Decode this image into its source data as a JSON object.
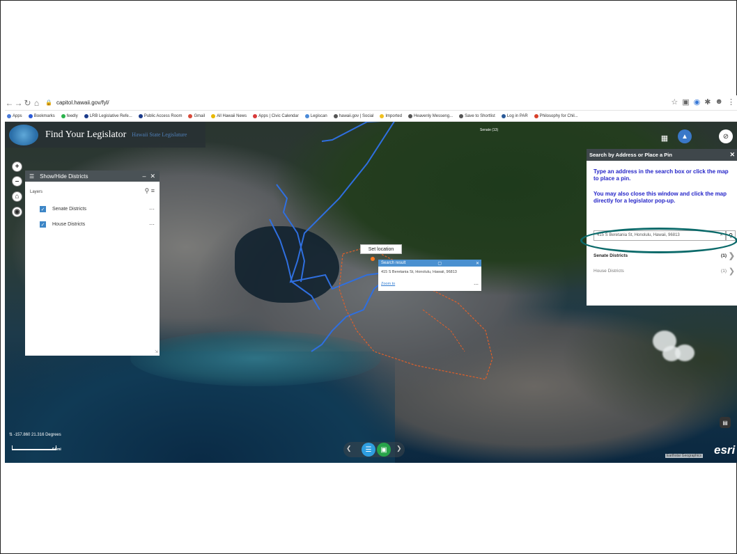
{
  "browser": {
    "url": "capitol.hawaii.gov/fyl/",
    "bookmarks": [
      "Apps",
      "Bookmarks",
      "feedly",
      "LRB Legislative Refe...",
      "Public Access Room",
      "Gmail",
      "All Hawaii News",
      "Apps | Civic Calendar",
      "Legiscan",
      "hawaii.gov | Social",
      "Imported",
      "Heavenly Messeng...",
      "Save to Shortlist",
      "Log in PAR",
      "Philosophy for Chil..."
    ]
  },
  "app": {
    "title": "Find Your Legislator",
    "subtitle": "Hawaii State Legislature"
  },
  "layers_panel": {
    "title": "Show/Hide Districts",
    "minimize": "–",
    "close": "✕",
    "label": "Layers",
    "layers": [
      "Senate Districts",
      "House Districts"
    ]
  },
  "search_panel": {
    "title": "Search by Address or Place a Pin",
    "close": "✕",
    "instructions1": "Type an address in the search box or click the map to place a pin.",
    "instructions2": "You may also close this window and click the map directly for a legislator pop-up.",
    "search_value": "415 S Beretania St, Honolulu, Hawaii, 96813",
    "clear": "✕",
    "results": [
      {
        "label": "Senate Districts",
        "count": "(1)"
      },
      {
        "label": "House Districts",
        "count": "(1)"
      }
    ]
  },
  "map": {
    "set_location": "Set location",
    "popup_title": "Search result",
    "popup_address": "415 S Beretania St, Honolulu, Hawaii, 96813",
    "zoom_to": "Zoom to",
    "coords": "-157.860 21.316 Degrees",
    "scale": "0.6mi",
    "label_top": "Senate (13)",
    "esri": "esri",
    "attribution": "Earthstar Geographics"
  }
}
